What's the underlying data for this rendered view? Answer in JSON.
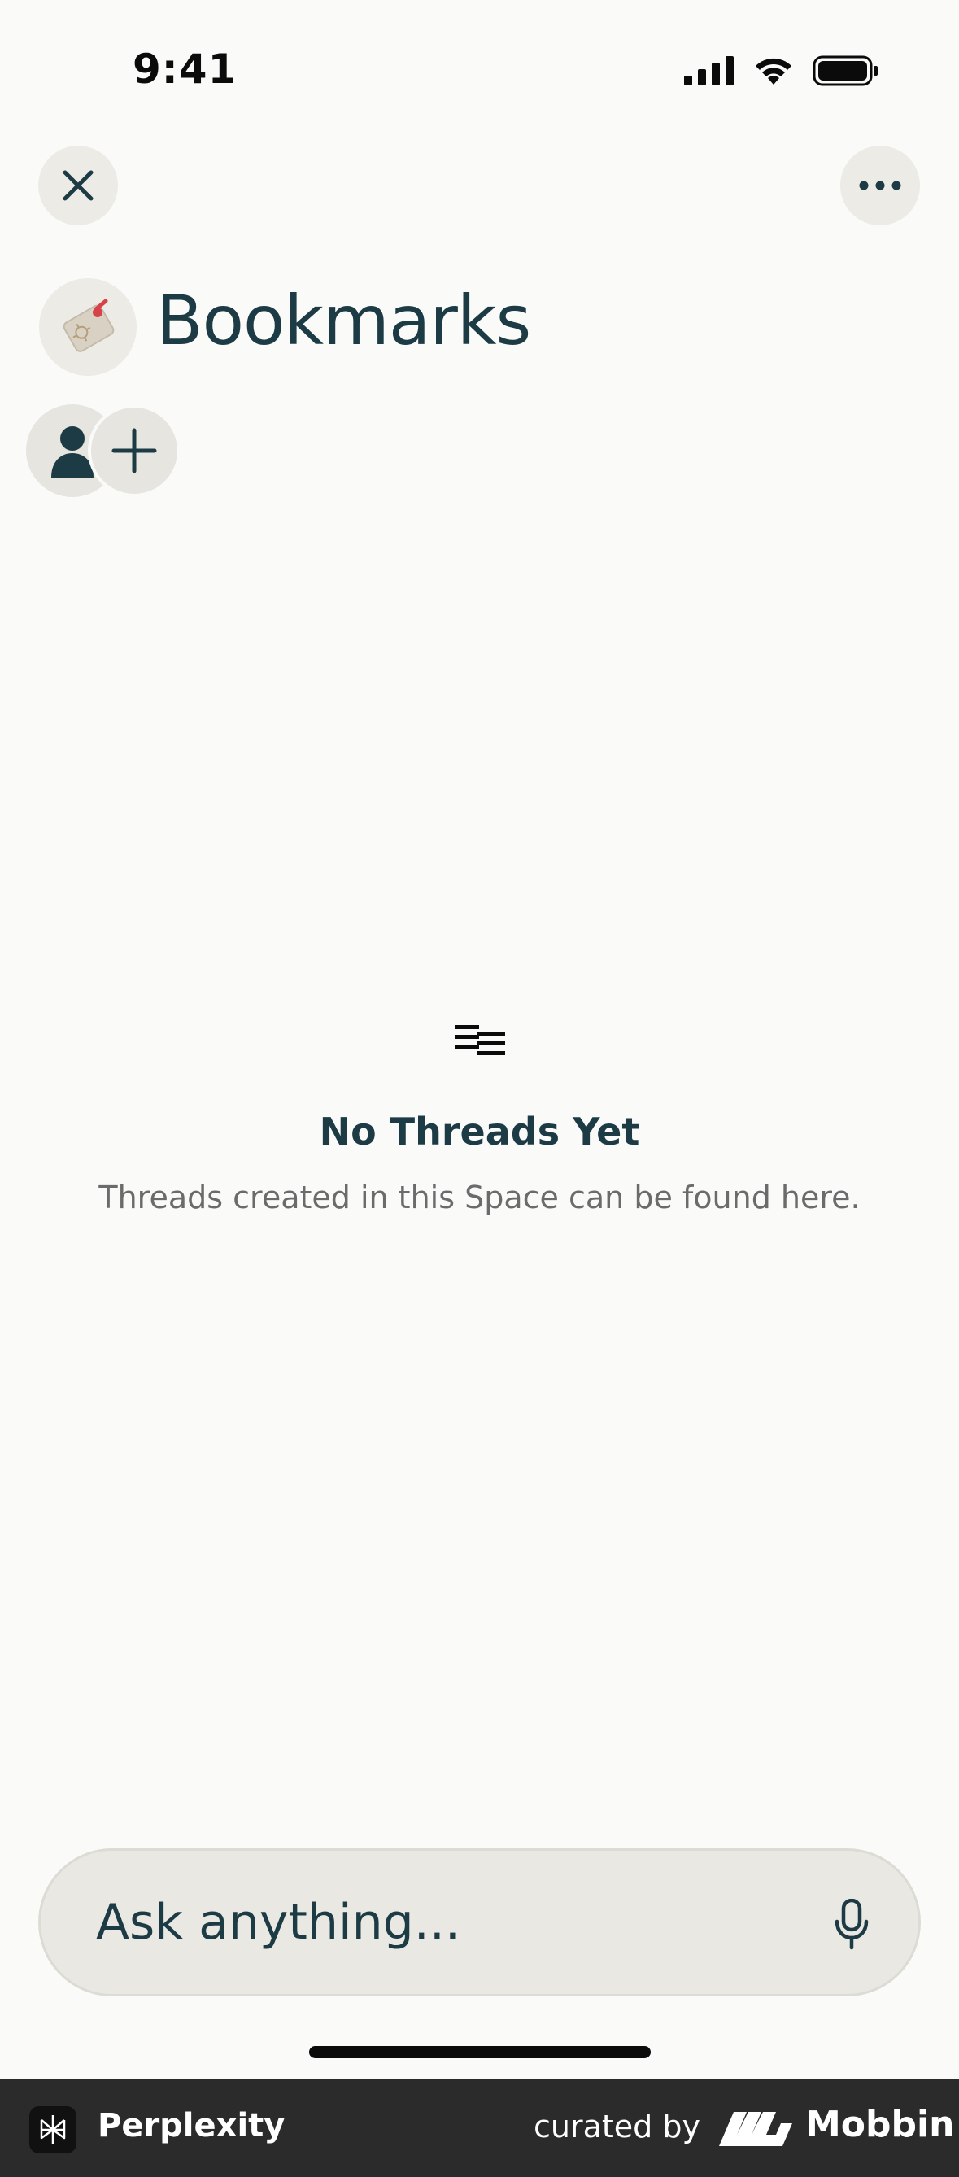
{
  "status_bar": {
    "time": "9:41"
  },
  "header": {
    "close_icon": "close-icon",
    "more_icon": "more-horizontal-icon"
  },
  "space": {
    "emoji_icon": "bookmark-tag-emoji",
    "title": "Bookmarks"
  },
  "members": {
    "avatar_icon": "person-icon",
    "add_icon": "plus-icon"
  },
  "empty_state": {
    "icon": "threads-list-icon",
    "title": "No Threads Yet",
    "subtitle": "Threads created in this Space can be found here."
  },
  "ask_bar": {
    "placeholder": "Ask anything...",
    "mic_icon": "microphone-icon"
  },
  "footer": {
    "app_name": "Perplexity",
    "curated_by": "curated by",
    "brand": "Mobbin"
  },
  "colors": {
    "background": "#fafaf8",
    "accent_text": "#1d3b45",
    "footer_bg": "#2b2b2b"
  }
}
